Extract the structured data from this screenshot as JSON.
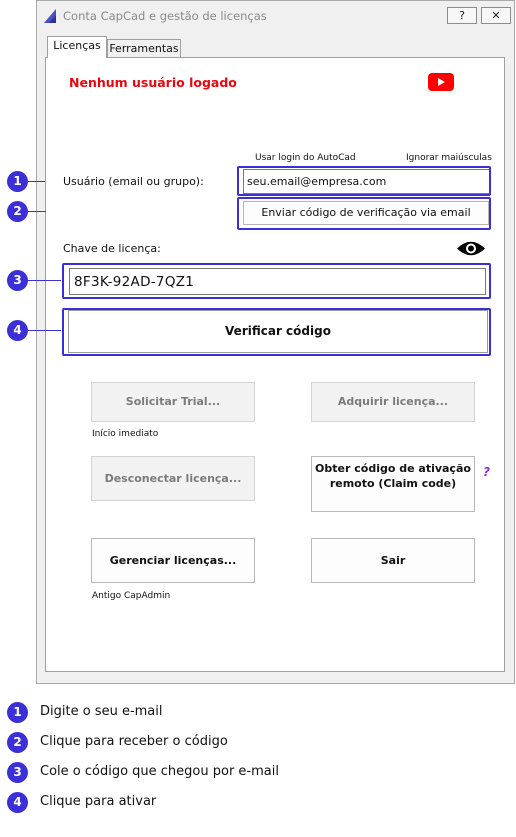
{
  "window": {
    "title": "Conta CapCad e gestão de licenças",
    "help_button": "?",
    "close_button": "✕"
  },
  "tabs": [
    {
      "label": "Licenças",
      "active": true
    },
    {
      "label": "Ferramentas",
      "active": false
    }
  ],
  "status": {
    "text": "Nenhum usuário logado",
    "color": "#e8070f"
  },
  "form": {
    "autocad_login_option": "Usar login do AutoCad",
    "ignore_case_option": "Ignorar maiúsculas",
    "user_label": "Usuário (email ou grupo):",
    "email_value": "seu.email@empresa.com",
    "send_code_button": "Enviar código de verificação via email",
    "license_label": "Chave de licença:",
    "license_value": "8F3K-92AD-7QZ1",
    "verify_button": "Verificar código"
  },
  "actions": {
    "trial_button": "Solicitar Trial...",
    "trial_note": "Início imediato",
    "buy_button": "Adquirir licença...",
    "disconnect_button": "Desconectar licença...",
    "claim_button": "Obter código de ativação remoto (Claim code)",
    "claim_help": "?",
    "manage_button": "Gerenciar licenças...",
    "manage_note": "Antigo CapAdmin",
    "exit_button": "Sair"
  },
  "annotations": {
    "accent_color": "#3b2fd8",
    "badges": [
      "1",
      "2",
      "3",
      "4"
    ],
    "legend": [
      {
        "number": "1",
        "text": "Digite o seu e-mail"
      },
      {
        "number": "2",
        "text": "Clique para receber o código"
      },
      {
        "number": "3",
        "text": "Cole o código que chegou por e-mail"
      },
      {
        "number": "4",
        "text": "Clique para ativar"
      }
    ]
  },
  "icons": {
    "app": "capcad-logo-icon",
    "youtube": "youtube-icon",
    "eye": "eye-icon"
  }
}
